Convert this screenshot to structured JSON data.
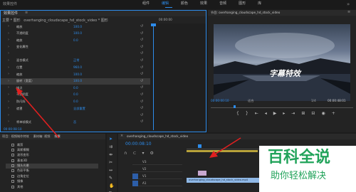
{
  "menu": {
    "app_label": "效果控件",
    "items": [
      "组件",
      "编辑",
      "颜色",
      "效果",
      "音频",
      "图形",
      "库"
    ],
    "active_index": 1
  },
  "effect_controls": {
    "tab_label": "效果控件",
    "source_label": "主要 * 图形",
    "clip_label": "overhanging_cloudscape_hd_stock_video * 图形",
    "timecode_top": "00:00:00",
    "sections": [
      {
        "label": "缩放",
        "value": "100.0"
      },
      {
        "label": "不透明度",
        "value": "100.0"
      },
      {
        "label": "缩放",
        "value": "0.0"
      },
      {
        "label": "变化属性",
        "value": ""
      },
      {
        "label": "",
        "value": ""
      },
      {
        "label": "混合模式",
        "value": "正常"
      },
      {
        "label": "位置",
        "value": "960.0"
      },
      {
        "label": "缩放",
        "value": "100.0"
      },
      {
        "label": "旋转（宽度）",
        "value": "100.0"
      },
      {
        "label": "锚点",
        "value": "0.0"
      },
      {
        "label": "不透明度",
        "value": "0.0"
      },
      {
        "label": "防闪烁",
        "value": "0.0"
      },
      {
        "label": "遮罩",
        "value": "全部重置"
      },
      {
        "label": "",
        "value": ""
      },
      {
        "label": "将单帧模式",
        "value": "否"
      }
    ],
    "timecode_bottom": "00:00:08:10"
  },
  "program_monitor": {
    "title": "节目: overhanging_cloudscape_hd_stock_video",
    "overlay_text": "字幕特效",
    "timecode_left": "00:00:00:10",
    "fit_label": "适合",
    "quality_label": "1/4",
    "timecode_right": "00:00:48:01"
  },
  "project": {
    "tabs": [
      "项目：视频制作特效",
      "素材箱: 视频",
      "效果"
    ],
    "active_tab": 2,
    "items": [
      "裁剪",
      "高斯模糊",
      "波形变形",
      "基本3D",
      "镜头光晕",
      "色彩平衡",
      "边角定位",
      "镜像",
      "其他"
    ]
  },
  "timeline": {
    "title": "overhanging_cloudscape_hd_stock_video",
    "timecode": "00:00:08:10",
    "track_labels": [
      "V3",
      "V2",
      "V1",
      "A1"
    ],
    "clip_label": "overhanging_cloudscape_hd_stock_video.mp4"
  },
  "watermark": {
    "line1": "百科全说",
    "line2": "助你轻松解决"
  },
  "colors": {
    "accent": "#2d8ceb",
    "clip_blue": "#8fb8e6",
    "arrow_red": "#e02020",
    "keyframe_bar": "#3f5f8a"
  }
}
